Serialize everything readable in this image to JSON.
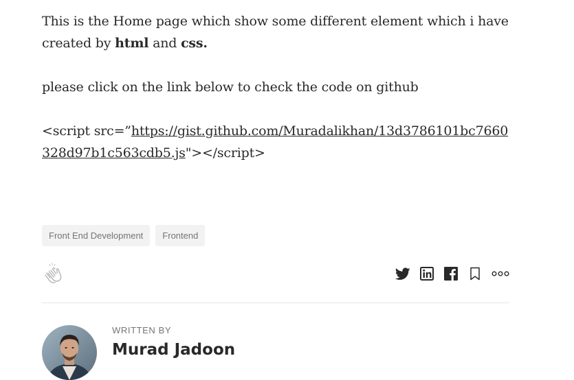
{
  "article": {
    "intro_prefix": "This is the Home page which show some different element which i have created by ",
    "intro_bold_1": "html",
    "intro_mid": " and ",
    "intro_bold_2": "css.",
    "link_prompt": "please click on the link below to check the code on github",
    "script_open": "<script src=”",
    "gist_url": "https://gist.github.com/Muradalikhan/13d3786101bc7660328d97b1c563cdb5.js",
    "script_close": "\"></script>"
  },
  "tags": [
    "Front End Development",
    "Frontend"
  ],
  "actions": {
    "clap_icon": "clap-icon",
    "share_icons": [
      "twitter-icon",
      "linkedin-icon",
      "facebook-icon",
      "bookmark-icon",
      "more-icon"
    ],
    "icon_color": "#292929",
    "clap_color": "#b3b3b3"
  },
  "author": {
    "written_by": "WRITTEN BY",
    "name": "Murad Jadoon"
  }
}
